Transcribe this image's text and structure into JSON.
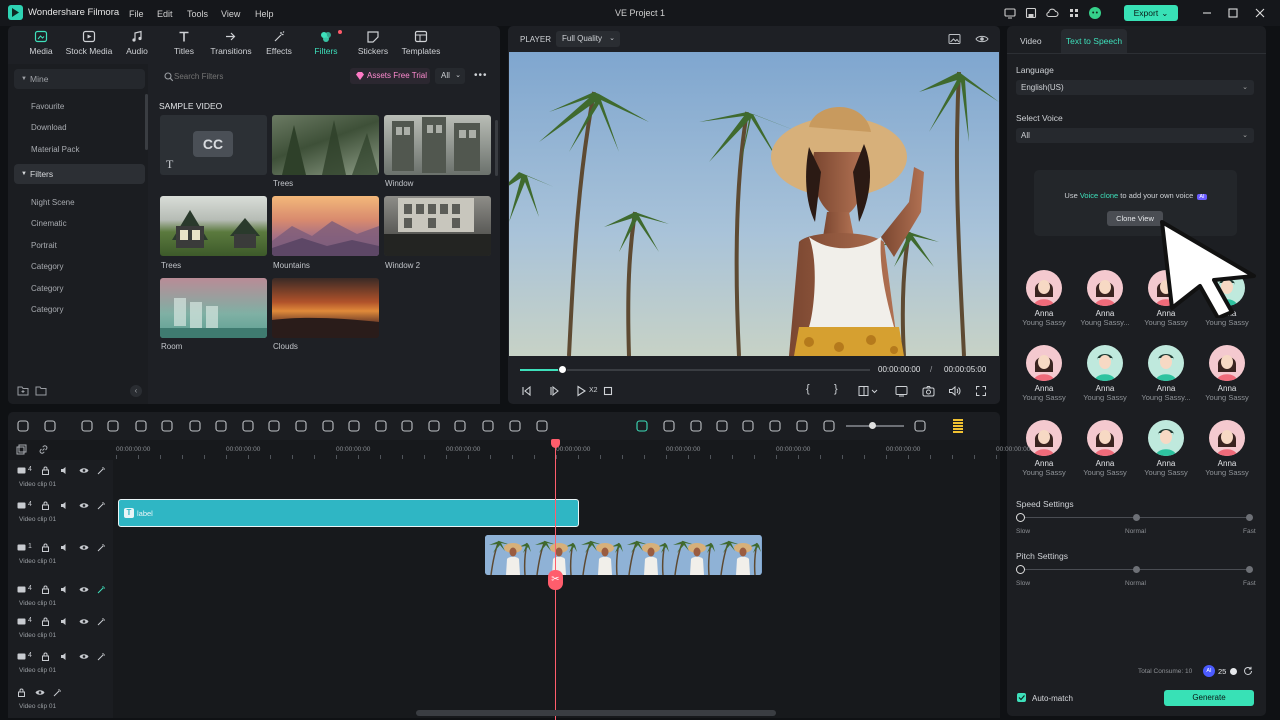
{
  "titlebar": {
    "app_name": "Wondershare Filmora",
    "menus": [
      "File",
      "Edit",
      "Tools",
      "View",
      "Help"
    ],
    "project": "VE Project 1",
    "export_label": "Export",
    "accent": "#38e1b6"
  },
  "library": {
    "tabs": [
      {
        "label": "Media",
        "icon": "media-icon",
        "active": false
      },
      {
        "label": "Stock Media",
        "icon": "stock-media-icon",
        "active": false
      },
      {
        "label": "Audio",
        "icon": "music-note-icon",
        "active": false
      },
      {
        "label": "Titles",
        "icon": "titles-icon",
        "active": false
      },
      {
        "label": "Transitions",
        "icon": "transitions-icon",
        "active": false
      },
      {
        "label": "Effects",
        "icon": "effects-icon",
        "active": false
      },
      {
        "label": "Filters",
        "icon": "filters-icon",
        "active": true
      },
      {
        "label": "Stickers",
        "icon": "stickers-icon",
        "active": false
      },
      {
        "label": "Templates",
        "icon": "templates-icon",
        "active": false
      }
    ],
    "sidebar": {
      "mine": "Mine",
      "mine_items": [
        "Favourite",
        "Download",
        "Material Pack"
      ],
      "filters": "Filters",
      "filter_items": [
        "Night Scene",
        "Cinematic",
        "Portrait",
        "Category",
        "Category",
        "Category"
      ]
    },
    "search_placeholder": "Search Filters",
    "assets_trial": "Assets Free Trial",
    "filter_all": "All",
    "section_title": "SAMPLE VIDEO",
    "thumbs": [
      {
        "label": "",
        "caption": "CC"
      },
      {
        "label": "Trees"
      },
      {
        "label": "Window"
      },
      {
        "label": "Trees"
      },
      {
        "label": "Mountains"
      },
      {
        "label": "Window 2"
      },
      {
        "label": "Room"
      },
      {
        "label": "Clouds"
      }
    ]
  },
  "player": {
    "label": "PLAYER",
    "quality": "Full Quality",
    "current_time": "00:00:00:00",
    "separator": "/",
    "total_time": "00:00:05:00",
    "progress": 0.12,
    "speed": "X2"
  },
  "tts": {
    "tabs": [
      "Video",
      "Text to Speech"
    ],
    "language_label": "Language",
    "language_value": "English(US)",
    "voice_label": "Select Voice",
    "voice_value": "All",
    "clone_text_pre": "Use ",
    "clone_link": "Voice clone",
    "clone_text_post": " to add your own voice",
    "clone_badge": "AI",
    "clone_button": "Clone View",
    "voices": [
      {
        "name": "Anna",
        "style": "Young Sassy",
        "gender": "f"
      },
      {
        "name": "Anna",
        "style": "Young Sassy...",
        "gender": "f"
      },
      {
        "name": "Anna",
        "style": "Young Sassy",
        "gender": "f"
      },
      {
        "name": "Anna",
        "style": "Young Sassy",
        "gender": "m"
      },
      {
        "name": "Anna",
        "style": "Young Sassy",
        "gender": "f"
      },
      {
        "name": "Anna",
        "style": "Young Sassy",
        "gender": "m"
      },
      {
        "name": "Anna",
        "style": "Young Sassy...",
        "gender": "m"
      },
      {
        "name": "Anna",
        "style": "Young Sassy",
        "gender": "f"
      },
      {
        "name": "Anna",
        "style": "Young Sassy",
        "gender": "f"
      },
      {
        "name": "Anna",
        "style": "Young Sassy",
        "gender": "f"
      },
      {
        "name": "Anna",
        "style": "Young Sassy",
        "gender": "m"
      },
      {
        "name": "Anna",
        "style": "Young Sassy",
        "gender": "f"
      }
    ],
    "speed_label": "Speed Settings",
    "pitch_label": "Pitch Settings",
    "slow": "Slow",
    "normal": "Normal",
    "fast": "Fast",
    "speed_value": 0,
    "pitch_value": 0,
    "total_consume": "Total Consume: 10",
    "credits": "25",
    "auto_match": "Auto-match",
    "generate": "Generate"
  },
  "timeline": {
    "ruler": [
      "00:00:00:00",
      "00:00:00:00",
      "00:00:00:00",
      "00:00:00:00",
      "00:00:00:00",
      "00:00:00:00",
      "00:00:00:00",
      "00:00:00:00",
      "00:00:00:00"
    ],
    "tracks": [
      {
        "num": "4",
        "name": "Video clip 01"
      },
      {
        "num": "4",
        "name": "Video clip 01"
      },
      {
        "num": "1",
        "name": "Video clip 01"
      },
      {
        "num": "4",
        "name": "Video clip 01"
      },
      {
        "num": "4",
        "name": "Video clip 01"
      },
      {
        "num": "4",
        "name": "Video clip 01"
      },
      {
        "num": "",
        "name": "Video clip 01"
      }
    ],
    "title_clip_label": "label"
  }
}
